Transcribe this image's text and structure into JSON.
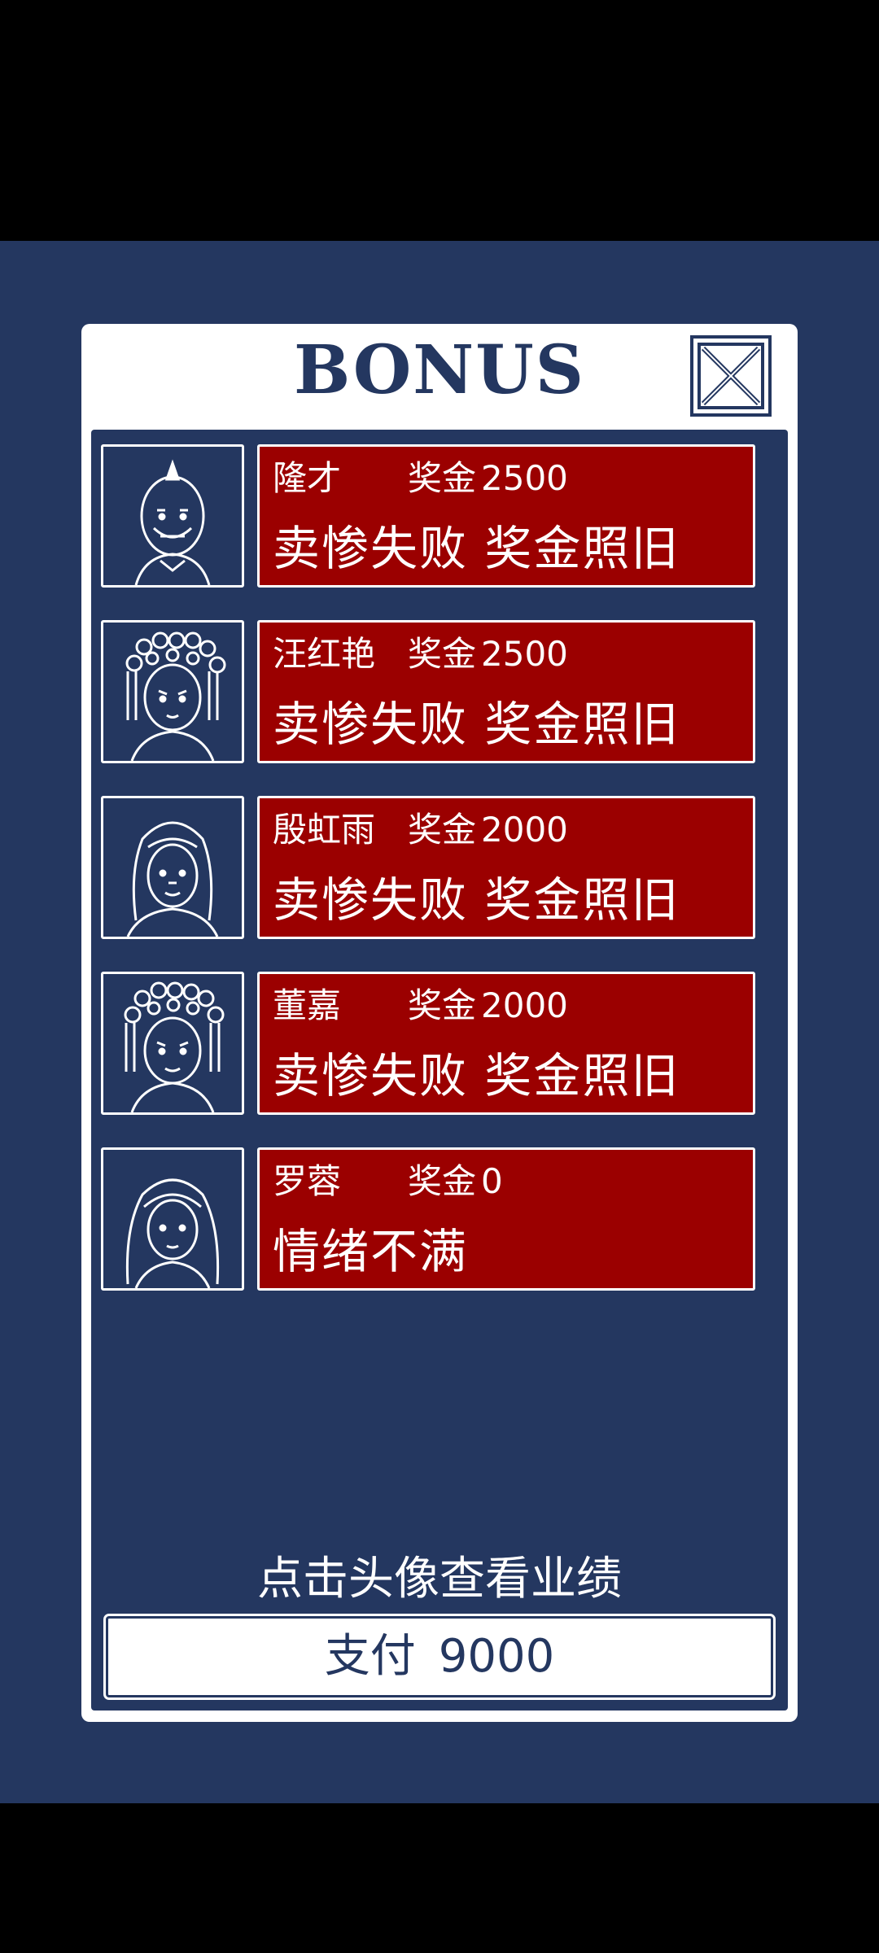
{
  "dialog": {
    "title": "BONUS",
    "close_icon": "close-x-icon"
  },
  "employees": [
    {
      "name": "隆才",
      "bonus_label": "奖金",
      "bonus_value": "2500",
      "status": "卖惨失败 奖金照旧",
      "portrait_icon": "bald-man-portrait-icon"
    },
    {
      "name": "汪红艳",
      "bonus_label": "奖金",
      "bonus_value": "2500",
      "status": "卖惨失败 奖金照旧",
      "portrait_icon": "opera-woman-portrait-icon"
    },
    {
      "name": "殷虹雨",
      "bonus_label": "奖金",
      "bonus_value": "2000",
      "status": "卖惨失败 奖金照旧",
      "portrait_icon": "long-hair-woman-portrait-icon"
    },
    {
      "name": "董嘉",
      "bonus_label": "奖金",
      "bonus_value": "2000",
      "status": "卖惨失败 奖金照旧",
      "portrait_icon": "opera-woman-portrait-icon"
    },
    {
      "name": "罗蓉",
      "bonus_label": "奖金",
      "bonus_value": "0",
      "status": "情绪不满",
      "portrait_icon": "long-hair-woman-portrait-icon"
    }
  ],
  "hint": "点击头像查看业绩",
  "pay": {
    "label": "支付",
    "amount": "9000"
  },
  "colors": {
    "background": "#243760",
    "row_fill": "#9b0000",
    "panel": "#ffffff",
    "outer": "#000000"
  }
}
